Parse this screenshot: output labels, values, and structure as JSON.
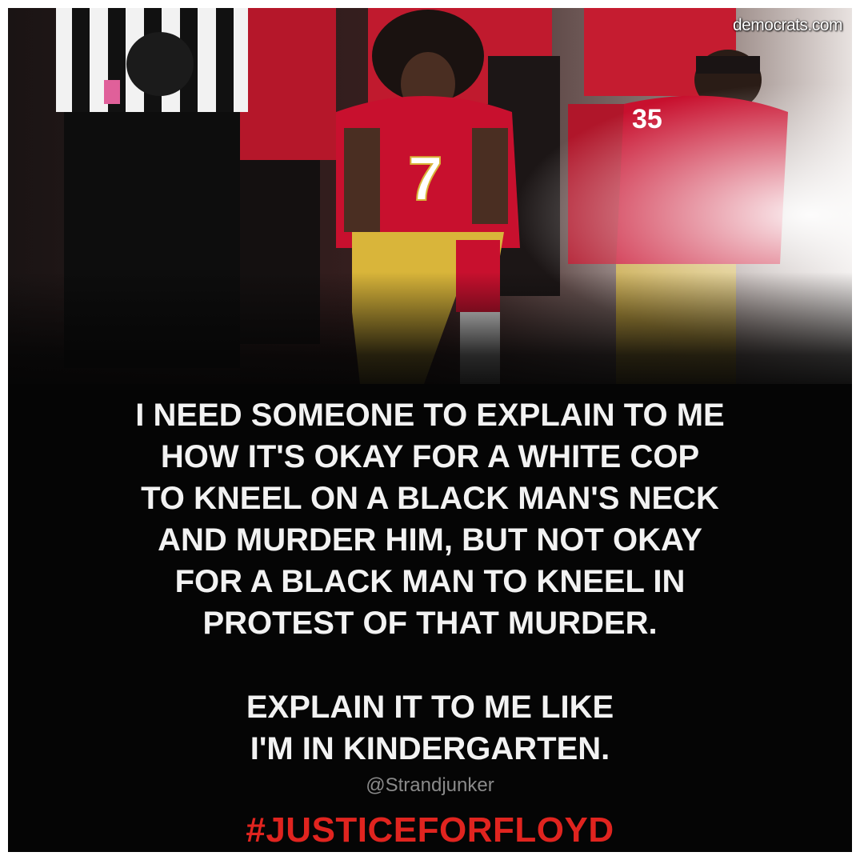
{
  "watermark": "democrats.com",
  "quote_lines": [
    "I NEED SOMEONE TO EXPLAIN TO ME",
    "HOW IT'S OKAY FOR A WHITE COP",
    "TO KNEEL ON A BLACK MAN'S NECK",
    "AND MURDER HIM, BUT NOT OKAY",
    "FOR A BLACK MAN TO KNEEL IN",
    "PROTEST OF THAT MURDER."
  ],
  "quote2_lines": [
    "EXPLAIN IT TO ME LIKE",
    "I'M IN KINDERGARTEN."
  ],
  "handle": "@Strandjunker",
  "hashtag": "#JUSTICEFORFLOYD",
  "colors": {
    "hashtag": "#e0241f",
    "jersey_red": "#c8102e",
    "pants_gold": "#d9b53a",
    "background": "#050505"
  }
}
